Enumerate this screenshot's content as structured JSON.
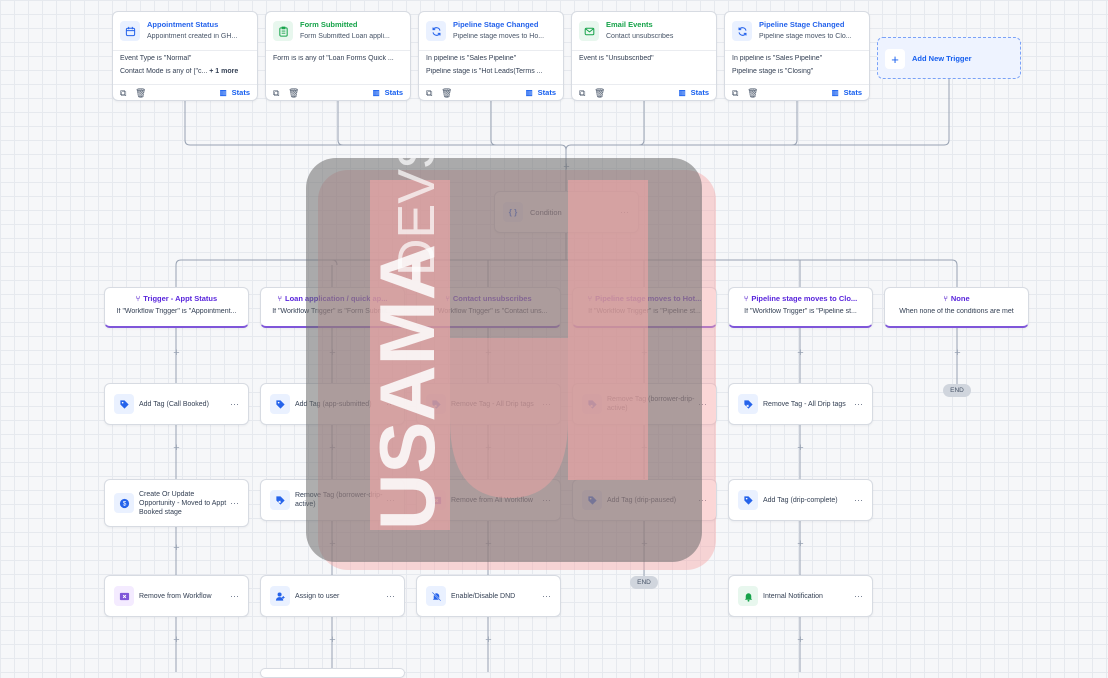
{
  "triggers": [
    {
      "title": "Appointment Status",
      "subtitle": "Appointment created in GH...",
      "line1": "Event Type is \"Normal\"",
      "line2": "Contact Mode is any of [\"c...",
      "more": "+ 1 more",
      "stats": "Stats",
      "icon": "calendar-icon",
      "color": "#2563eb",
      "bg": "#eaf1ff"
    },
    {
      "title": "Form Submitted",
      "subtitle": "Form Submitted Loan appli...",
      "line1": "Form is is any of \"Loan Forms Quick ...",
      "line2": "",
      "more": "",
      "stats": "Stats",
      "icon": "clipboard-icon",
      "color": "#16a34a",
      "bg": "#e8f7ee"
    },
    {
      "title": "Pipeline Stage Changed",
      "subtitle": "Pipeline stage moves to Ho...",
      "line1": "In pipeline is \"Sales Pipeline\"",
      "line2": "Pipeline stage is \"Hot Leads(Terms ...",
      "more": "",
      "stats": "Stats",
      "icon": "refresh-icon",
      "color": "#2563eb",
      "bg": "#eaf1ff"
    },
    {
      "title": "Email Events",
      "subtitle": "Contact unsubscribes",
      "line1": "Event is \"Unsubscribed\"",
      "line2": "",
      "more": "",
      "stats": "Stats",
      "icon": "mail-icon",
      "color": "#16a34a",
      "bg": "#e8f7ee"
    },
    {
      "title": "Pipeline Stage Changed",
      "subtitle": "Pipeline stage moves to Clo...",
      "line1": "In pipeline is \"Sales Pipeline\"",
      "line2": "Pipeline stage is \"Closing\"",
      "more": "",
      "stats": "Stats",
      "icon": "refresh-icon",
      "color": "#2563eb",
      "bg": "#eaf1ff"
    }
  ],
  "add_trigger": "Add New Trigger",
  "condition": {
    "label": "Condition",
    "icon": "{ }"
  },
  "branches": [
    {
      "title": "Trigger - Appt Status",
      "sub": "If \"Workflow Trigger\" is \"Appointment..."
    },
    {
      "title": "Loan application / quick ap...",
      "sub": "If \"Workflow Trigger\" is \"Form Submit..."
    },
    {
      "title": "Contact unsubscribes",
      "sub": "If \"Workflow Trigger\" is \"Contact uns..."
    },
    {
      "title": "Pipeline stage moves to Hot...",
      "sub": "If \"Workflow Trigger\" is \"Pipeline st..."
    },
    {
      "title": "Pipeline stage moves to Clo...",
      "sub": "If \"Workflow Trigger\" is \"Pipeline st..."
    },
    {
      "title": "None",
      "sub": "When none of the conditions are met"
    }
  ],
  "actions": {
    "row1": [
      "Add Tag (Call Booked)",
      "Add Tag (app-submitted)",
      "Remove Tag - All Drip tags",
      "Remove Tag (borrower-drip-active)",
      "Remove Tag - All Drip tags"
    ],
    "row2": [
      "Create Or Update Opportunity - Moved to Appt Booked stage",
      "Remove Tag (borrower-drip-active)",
      "Remove from All Workflow",
      "Add Tag (drip-paused)",
      "Add Tag (drip-complete)"
    ],
    "row3": [
      "Remove from Workflow",
      "Assign to user",
      "Enable/Disable DND",
      "Internal Notification"
    ]
  },
  "end_label": "END",
  "watermark": {
    "text1": "USAMA",
    "text2": "DEVS"
  }
}
